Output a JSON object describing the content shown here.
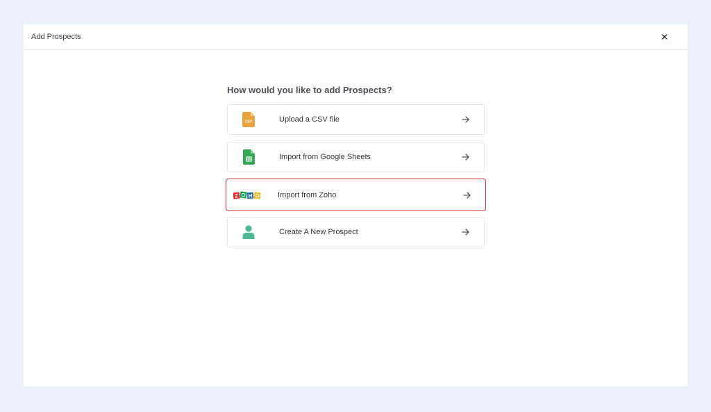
{
  "modal": {
    "title": "Add Prospects",
    "close_icon": "close-icon"
  },
  "question": "How would you like to add Prospects?",
  "options": [
    {
      "label": "Upload a CSV file",
      "icon": "csv-file-icon",
      "icon_text": "CSV",
      "color": "#e8a33d"
    },
    {
      "label": "Import from Google Sheets",
      "icon": "google-sheets-icon",
      "color": "#34a853"
    },
    {
      "label": "Import from Zoho",
      "icon": "zoho-logo-icon",
      "selected": true
    },
    {
      "label": "Create A New Prospect",
      "icon": "person-icon",
      "color": "#4fb897"
    }
  ],
  "colors": {
    "background": "#eef0fc",
    "selected_border": "#d42a2a"
  }
}
